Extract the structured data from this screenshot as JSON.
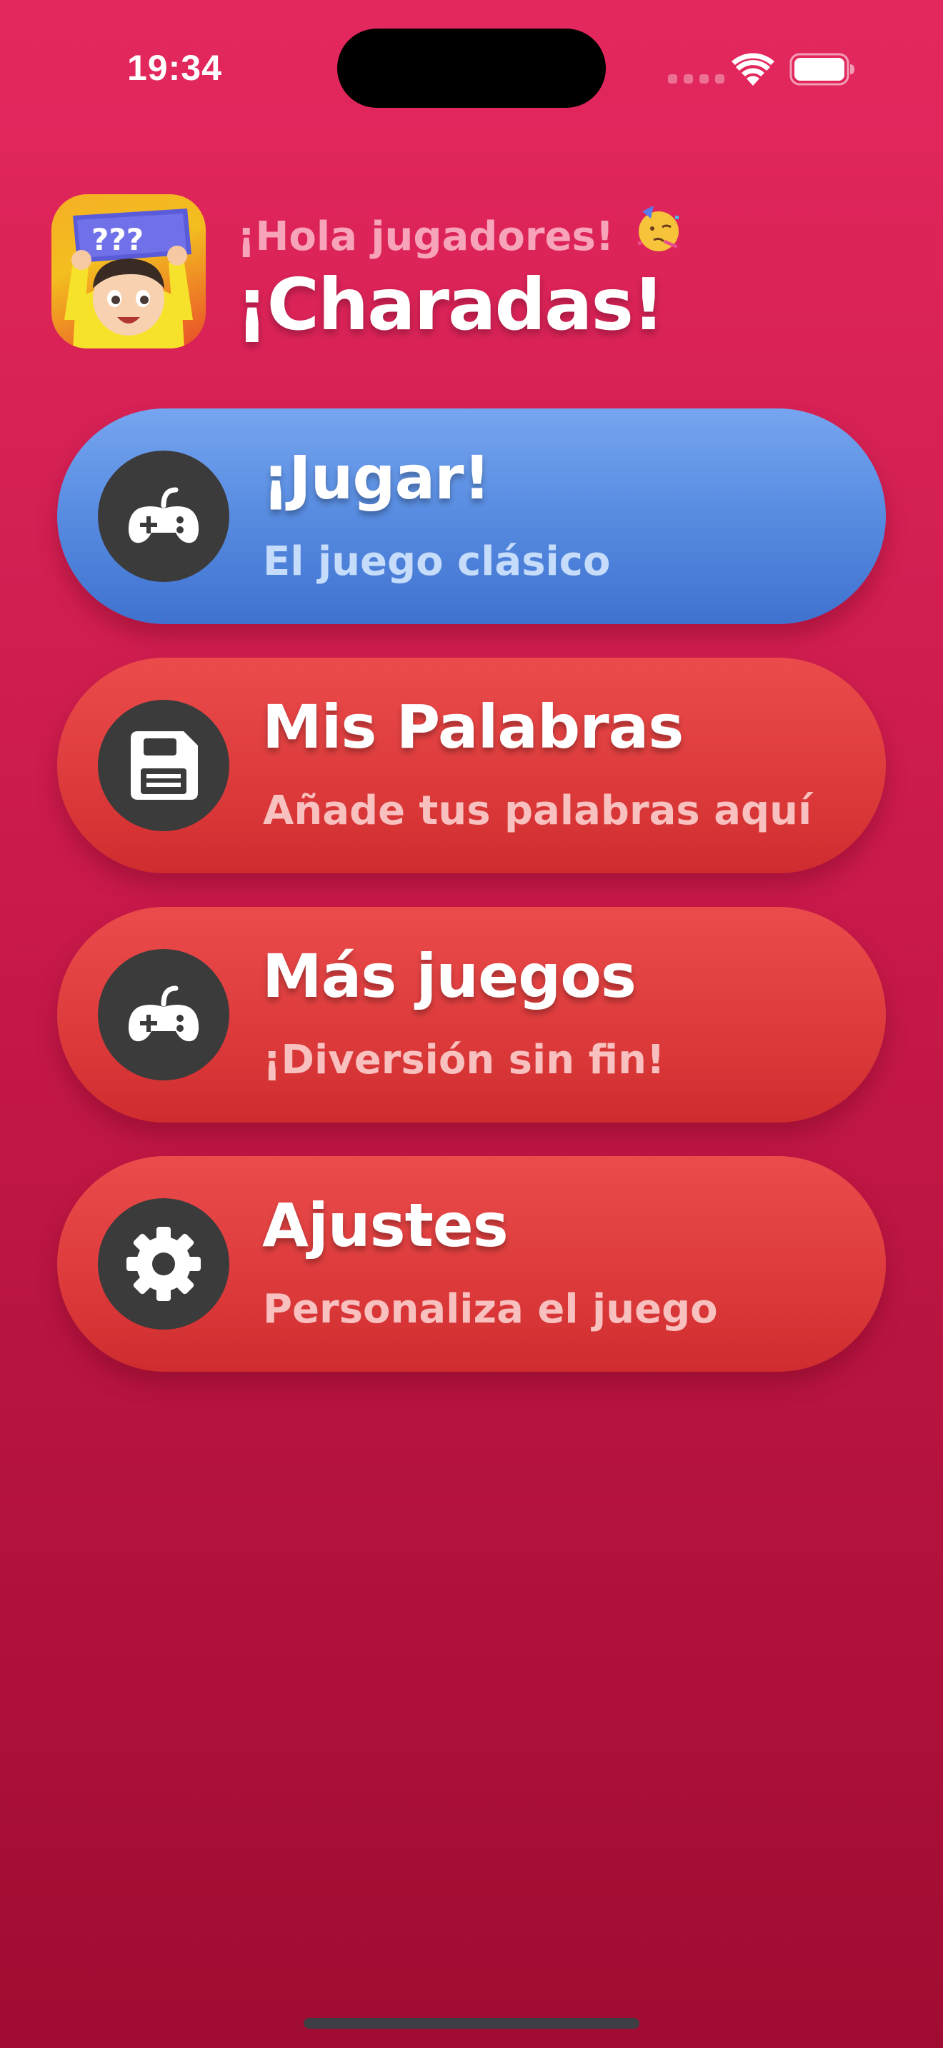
{
  "status_bar": {
    "time": "19:34",
    "icons": [
      "signal-icon",
      "wifi-icon",
      "battery-icon"
    ]
  },
  "header": {
    "logo_icon": "charades-boy-logo",
    "greeting": "¡Hola jugadores!",
    "greeting_emoji": "partying-face-emoji",
    "title": "¡Charadas!"
  },
  "menu": [
    {
      "title": "¡Jugar!",
      "subtitle": "El juego clásico",
      "icon": "gamepad-icon",
      "color": "#4F84DA"
    },
    {
      "title": "Mis Palabras",
      "subtitle": "Añade tus palabras aquí",
      "icon": "save-icon",
      "color": "#DE3C3C"
    },
    {
      "title": "Más juegos",
      "subtitle": "¡Diversión sin fin!",
      "icon": "gamepad-icon",
      "color": "#DE3C3C"
    },
    {
      "title": "Ajustes",
      "subtitle": "Personaliza el juego",
      "icon": "gear-icon",
      "color": "#DE3C3C"
    }
  ],
  "colors": {
    "background_top": "#E4285E",
    "background_bottom": "#A00C31",
    "icon_circle": "#3B3B3B"
  }
}
